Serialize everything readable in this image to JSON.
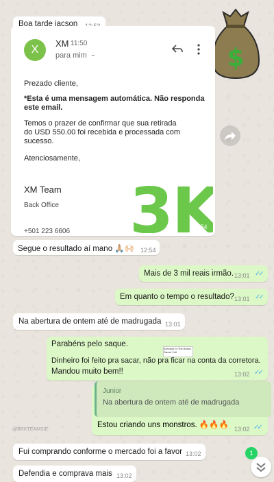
{
  "messages": [
    {
      "text": "Boa tarde jacson",
      "time": "12:53"
    },
    {
      "time": "12:54"
    },
    {
      "text": "Segue o resultado aí mano 🙏🏼🙌🏻",
      "time": "12:54"
    },
    {
      "text": "Mais de 3 mil reais irmão.",
      "time": "13:01"
    },
    {
      "text": "Em quanto o tempo o resultado?",
      "time": "13:01"
    },
    {
      "text": "Na abertura de ontem até  de madrugada",
      "time": "13:01"
    },
    {
      "line1": "Parabéns pelo saque.",
      "line2": "Dinheiro foi feito pra sacar, não pra ficar na conta da corretora.",
      "line3": "Mandou muito bem!!",
      "time": "13:02"
    },
    {
      "quote_author": "Junior",
      "quote_text": "Na abertura de ontem até  de madrugada",
      "text": "Estou criando uns monstros. 🔥🔥🔥",
      "time": "13:02"
    },
    {
      "text": "Fui comprando conforme o mercado foi a favor",
      "time": "13:02"
    },
    {
      "text": "Defendia e comprava mais",
      "time": "13:02"
    }
  ],
  "email": {
    "avatar_letter": "X",
    "sender": "XM",
    "time": "11:50",
    "recipient": "para mim",
    "greeting": "Prezado cliente,",
    "notice_line1": "*Esta é uma mensagem automática. Não responda",
    "notice_line2": "este email.",
    "body_line1": "Temos o prazer de confirmar que sua retirada",
    "body_line2": "do USD 550.00 foi recebida e processada com",
    "body_line3": "sucesso.",
    "closing": "Atenciosamente,",
    "team": "XM Team",
    "dept": "Back Office",
    "phone": "+501 223 6606",
    "overlay": "3K"
  },
  "thumbnail_text": "Ashvault In The Brown Sword Yull",
  "watermark": "@BRKTEAMSIE",
  "unread_count": "1",
  "icons": [
    "money-bag-icon",
    "forward-icon",
    "reply-icon",
    "more-vert-icon",
    "chevron-down-icon",
    "fire-icon",
    "double-check-icon",
    "scroll-down-icon"
  ],
  "colors": {
    "incoming": "#ffffff",
    "outgoing": "#dcf8c6",
    "accent_green": "#6cc84b",
    "check_blue": "#4fb6ec"
  }
}
